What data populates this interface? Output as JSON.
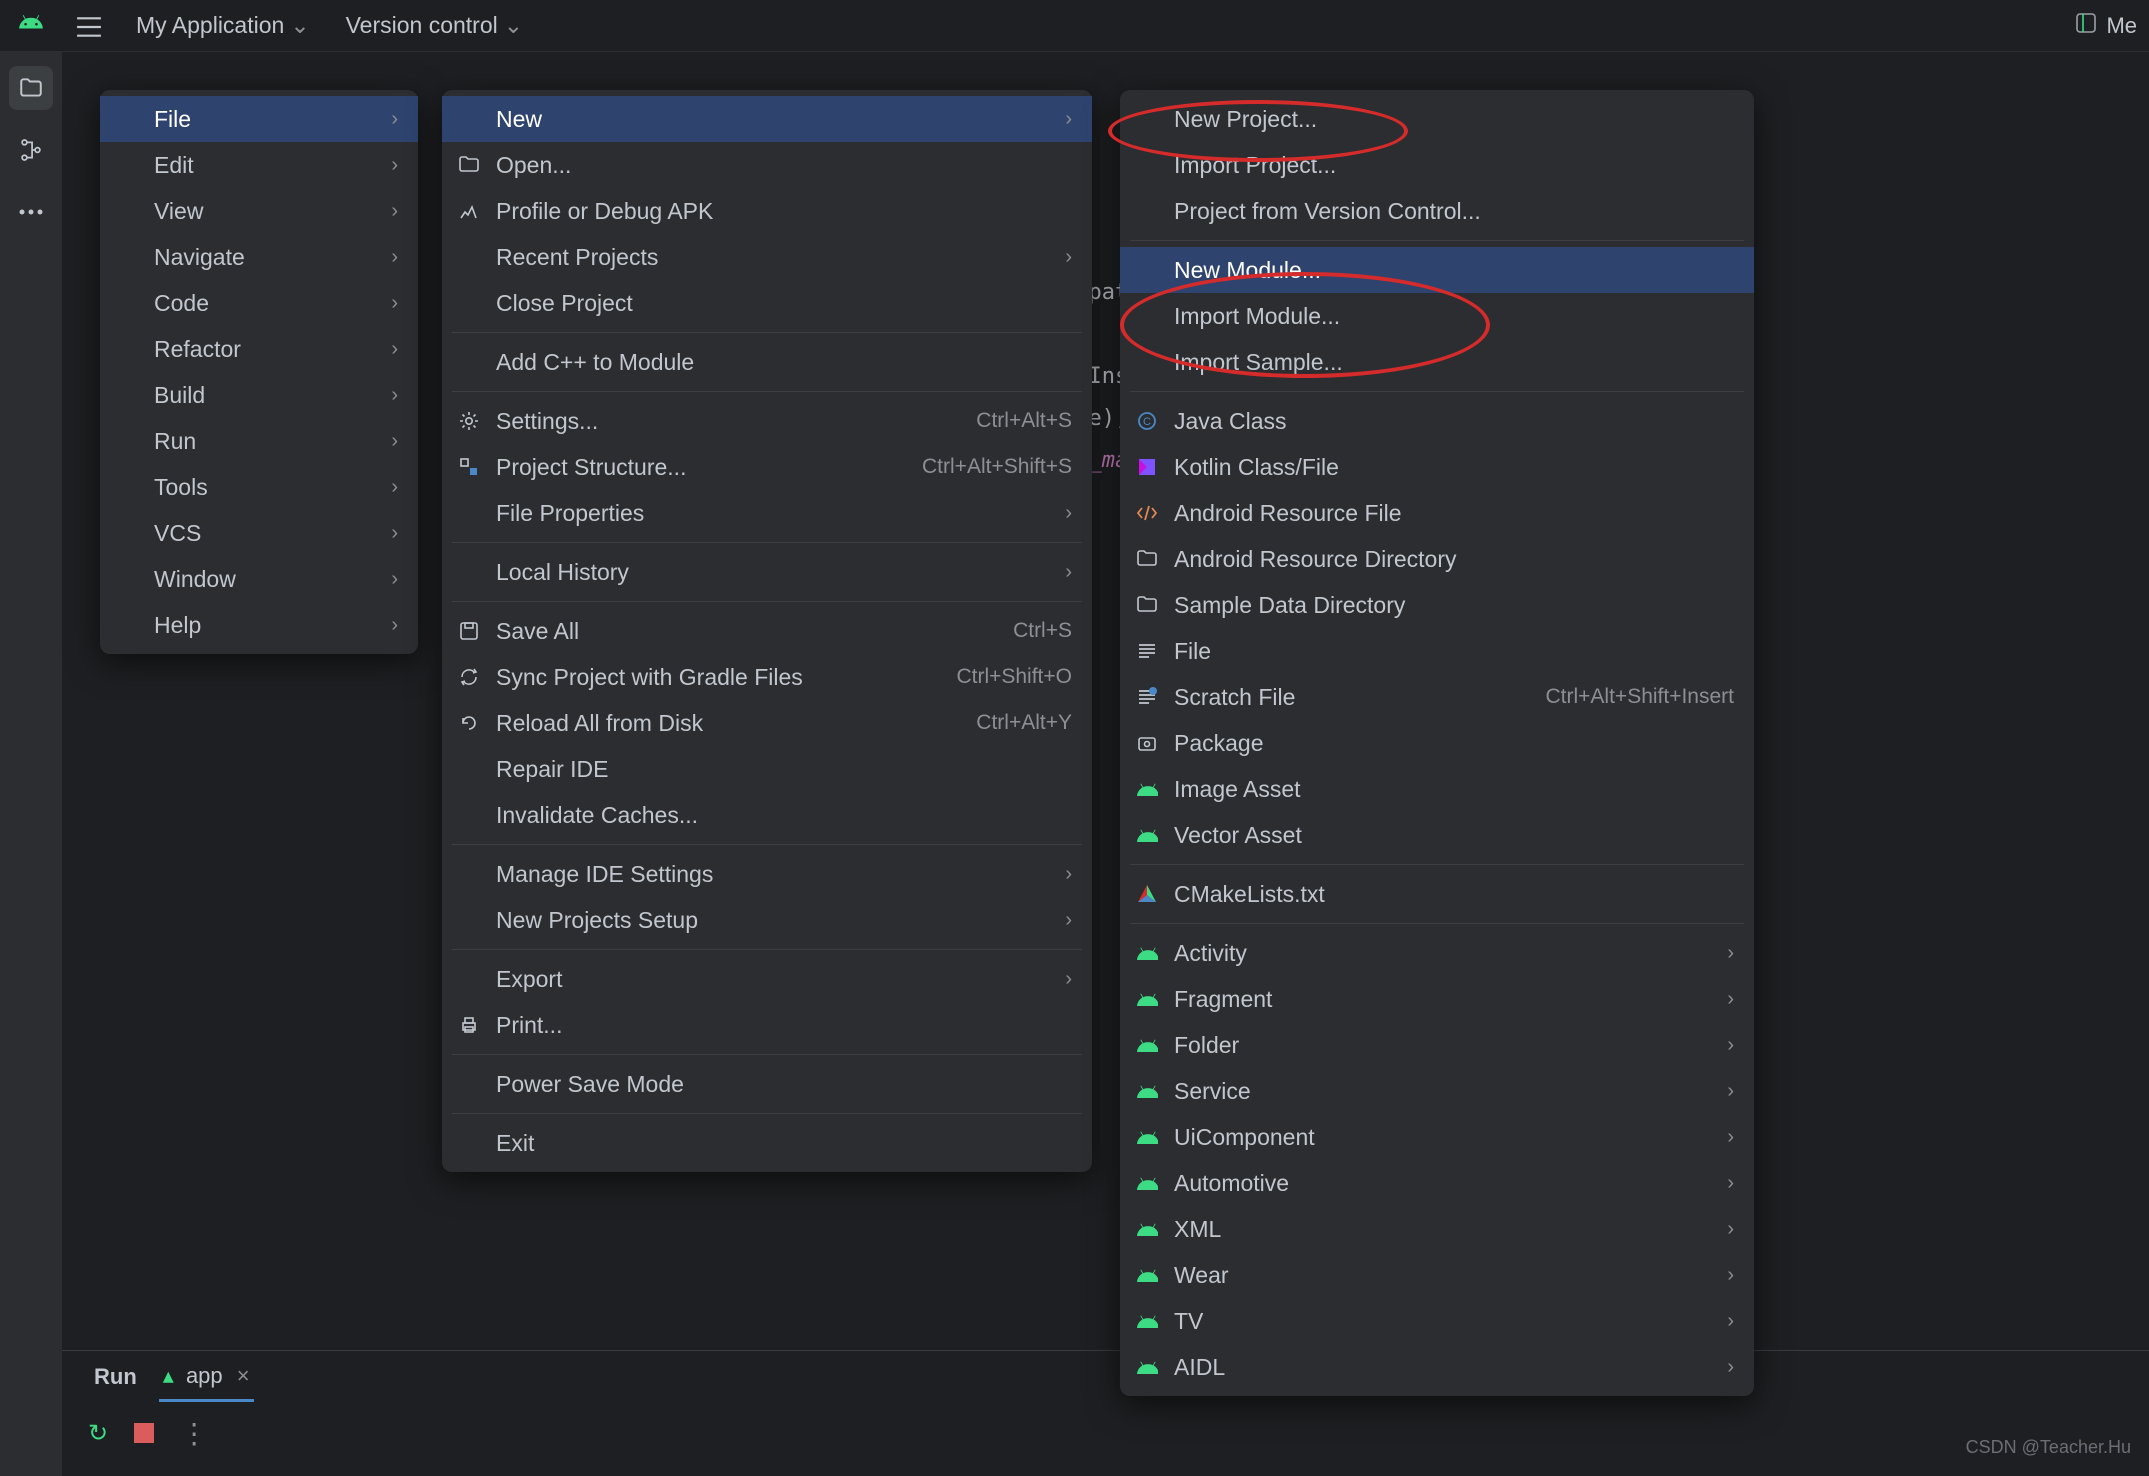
{
  "toolbar": {
    "project_name": "My Application",
    "vcs_label": "Version control",
    "right_label": "Me"
  },
  "file_menu": {
    "items": [
      {
        "label": "File",
        "sub": true,
        "hl": true
      },
      {
        "label": "Edit",
        "sub": true
      },
      {
        "label": "View",
        "sub": true
      },
      {
        "label": "Navigate",
        "sub": true
      },
      {
        "label": "Code",
        "sub": true
      },
      {
        "label": "Refactor",
        "sub": true
      },
      {
        "label": "Build",
        "sub": true
      },
      {
        "label": "Run",
        "sub": true
      },
      {
        "label": "Tools",
        "sub": true
      },
      {
        "label": "VCS",
        "sub": true
      },
      {
        "label": "Window",
        "sub": true
      },
      {
        "label": "Help",
        "sub": true
      }
    ]
  },
  "file_submenu": [
    {
      "label": "New",
      "sub": true,
      "hl": true
    },
    {
      "label": "Open...",
      "icon": "folder"
    },
    {
      "label": "Profile or Debug APK",
      "icon": "profile"
    },
    {
      "label": "Recent Projects",
      "sub": true
    },
    {
      "label": "Close Project"
    },
    {
      "type": "sep"
    },
    {
      "label": "Add C++ to Module"
    },
    {
      "type": "sep"
    },
    {
      "label": "Settings...",
      "icon": "gear",
      "sc": "Ctrl+Alt+S"
    },
    {
      "label": "Project Structure...",
      "icon": "structure",
      "sc": "Ctrl+Alt+Shift+S"
    },
    {
      "label": "File Properties",
      "sub": true
    },
    {
      "type": "sep"
    },
    {
      "label": "Local History",
      "sub": true
    },
    {
      "type": "sep"
    },
    {
      "label": "Save All",
      "icon": "save",
      "sc": "Ctrl+S"
    },
    {
      "label": "Sync Project with Gradle Files",
      "icon": "sync",
      "sc": "Ctrl+Shift+O"
    },
    {
      "label": "Reload All from Disk",
      "icon": "reload",
      "sc": "Ctrl+Alt+Y"
    },
    {
      "label": "Repair IDE"
    },
    {
      "label": "Invalidate Caches..."
    },
    {
      "type": "sep"
    },
    {
      "label": "Manage IDE Settings",
      "sub": true
    },
    {
      "label": "New Projects Setup",
      "sub": true
    },
    {
      "type": "sep"
    },
    {
      "label": "Export",
      "sub": true
    },
    {
      "label": "Print...",
      "icon": "print"
    },
    {
      "type": "sep"
    },
    {
      "label": "Power Save Mode"
    },
    {
      "type": "sep"
    },
    {
      "label": "Exit"
    }
  ],
  "new_submenu": [
    {
      "label": "New Project..."
    },
    {
      "label": "Import Project..."
    },
    {
      "label": "Project from Version Control..."
    },
    {
      "type": "sep"
    },
    {
      "label": "New Module...",
      "hl": true
    },
    {
      "label": "Import Module..."
    },
    {
      "label": "Import Sample..."
    },
    {
      "type": "sep"
    },
    {
      "label": "Java Class",
      "icon": "java"
    },
    {
      "label": "Kotlin Class/File",
      "icon": "kotlin"
    },
    {
      "label": "Android Resource File",
      "icon": "xmltag"
    },
    {
      "label": "Android Resource Directory",
      "icon": "folder"
    },
    {
      "label": "Sample Data Directory",
      "icon": "folder"
    },
    {
      "label": "File",
      "icon": "lines"
    },
    {
      "label": "Scratch File",
      "icon": "scratch",
      "sc": "Ctrl+Alt+Shift+Insert"
    },
    {
      "label": "Package",
      "icon": "package"
    },
    {
      "label": "Image Asset",
      "icon": "android"
    },
    {
      "label": "Vector Asset",
      "icon": "android"
    },
    {
      "type": "sep"
    },
    {
      "label": "CMakeLists.txt",
      "icon": "cmake"
    },
    {
      "type": "sep"
    },
    {
      "label": "Activity",
      "icon": "android",
      "sub": true
    },
    {
      "label": "Fragment",
      "icon": "android",
      "sub": true
    },
    {
      "label": "Folder",
      "icon": "android",
      "sub": true
    },
    {
      "label": "Service",
      "icon": "android",
      "sub": true
    },
    {
      "label": "UiComponent",
      "icon": "android",
      "sub": true
    },
    {
      "label": "Automotive",
      "icon": "android",
      "sub": true
    },
    {
      "label": "XML",
      "icon": "android",
      "sub": true
    },
    {
      "label": "Wear",
      "icon": "android",
      "sub": true
    },
    {
      "label": "TV",
      "icon": "android",
      "sub": true
    },
    {
      "label": "AIDL",
      "icon": "android",
      "sub": true
    }
  ],
  "bottom": {
    "run_tab": "Run",
    "app_tab": "app"
  },
  "code_lines": [
    "ompatActivity {",
    "",
    "edInstanceState) {",
    "ate);",
    "ty_main);"
  ],
  "watermark": "CSDN @Teacher.Hu"
}
